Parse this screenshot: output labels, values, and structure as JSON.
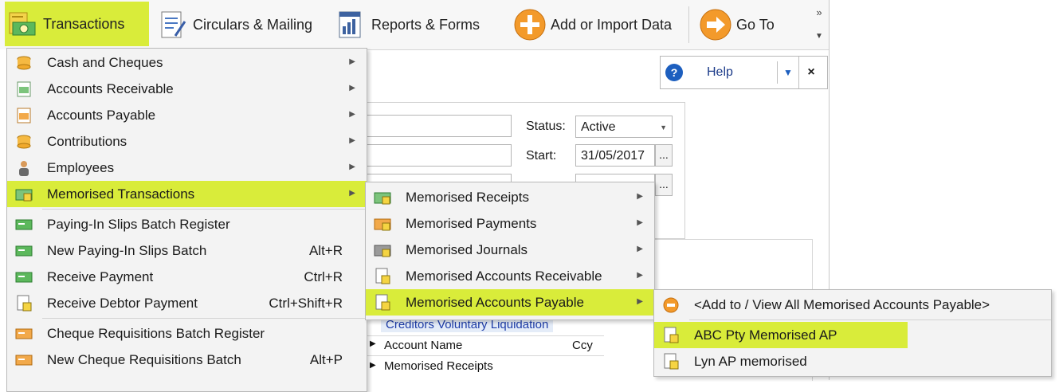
{
  "toolbar": {
    "buttons": [
      {
        "label": "Transactions",
        "icon": "transactions-icon"
      },
      {
        "label": "Circulars & Mailing",
        "icon": "circulars-icon"
      },
      {
        "label": "Reports & Forms",
        "icon": "reports-icon"
      },
      {
        "label": "Add or Import Data",
        "icon": "add-data-icon"
      },
      {
        "label": "Go To",
        "icon": "goto-icon"
      }
    ],
    "overflow_glyph": "»",
    "dropdown_glyph": "▼"
  },
  "help": {
    "label": "Help",
    "close": "×",
    "icon_glyph": "?"
  },
  "form": {
    "status_label": "Status:",
    "status_value": "Active",
    "start_label": "Start:",
    "start_value": "31/05/2017",
    "dots": "..."
  },
  "grid": {
    "caption": "Creditors Voluntary Liquidation",
    "col_account": "Account Name",
    "col_ccy": "Ccy",
    "row1": "Memorised Receipts"
  },
  "menu_main": [
    {
      "label": "Cash and Cheques",
      "shortcut": "",
      "submenu": true
    },
    {
      "label": "Accounts Receivable",
      "shortcut": "",
      "submenu": true
    },
    {
      "label": "Accounts Payable",
      "shortcut": "",
      "submenu": true
    },
    {
      "label": "Contributions",
      "shortcut": "",
      "submenu": true
    },
    {
      "label": "Employees",
      "shortcut": "",
      "submenu": true
    },
    {
      "label": "Memorised Transactions",
      "shortcut": "",
      "submenu": true,
      "highlighted": true
    },
    {
      "label": "Paying-In Slips Batch Register",
      "shortcut": "",
      "submenu": false
    },
    {
      "label": "New Paying-In Slips Batch",
      "shortcut": "Alt+R",
      "submenu": false
    },
    {
      "label": "Receive Payment",
      "shortcut": "Ctrl+R",
      "submenu": false
    },
    {
      "label": "Receive Debtor Payment",
      "shortcut": "Ctrl+Shift+R",
      "submenu": false
    },
    {
      "label": "Cheque Requisitions Batch Register",
      "shortcut": "",
      "submenu": false
    },
    {
      "label": "New Cheque Requisitions Batch",
      "shortcut": "Alt+P",
      "submenu": false
    }
  ],
  "menu_memorised": [
    {
      "label": "Memorised Receipts",
      "submenu": true
    },
    {
      "label": "Memorised Payments",
      "submenu": true
    },
    {
      "label": "Memorised Journals",
      "submenu": true
    },
    {
      "label": "Memorised Accounts Receivable",
      "submenu": true
    },
    {
      "label": "Memorised Accounts Payable",
      "submenu": true,
      "highlighted": true
    }
  ],
  "menu_ap": [
    {
      "label": "<Add to / View All Memorised Accounts Payable>"
    },
    {
      "label": "ABC Pty Memorised AP",
      "highlighted": true
    },
    {
      "label": "Lyn AP memorised"
    }
  ],
  "colors": {
    "highlight": "#d9ec3a",
    "menu_bg": "#f3f3f3",
    "link_blue": "#1d3ca8"
  }
}
